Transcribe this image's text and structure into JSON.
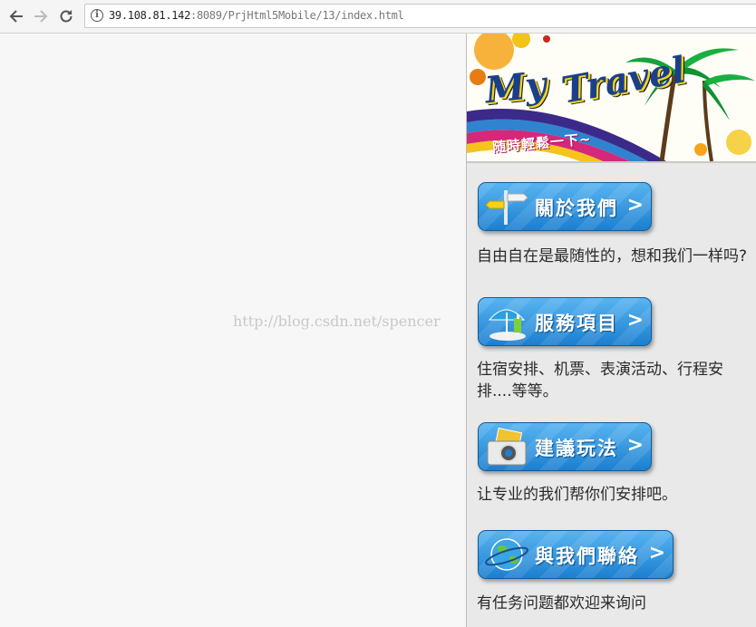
{
  "browser": {
    "url_host": "39.108.81.142",
    "url_rest": ":8089/PrjHtml5Mobile/13/index.html"
  },
  "watermark": "http://blog.csdn.net/spencer",
  "banner": {
    "title_word1": "My",
    "title_word2": "Travel",
    "subtitle": "随時輕鬆一下~"
  },
  "menu": [
    {
      "label": "關於我們",
      "chevron": ">",
      "desc": "自由自在是最随性的，想和我们一样吗?"
    },
    {
      "label": "服務項目",
      "chevron": ">",
      "desc": "住宿安排、机票、表演活动、行程安排....等等。"
    },
    {
      "label": "建議玩法",
      "chevron": ">",
      "desc": "让专业的我们帮你们安排吧。"
    },
    {
      "label": "與我們聯絡",
      "chevron": ">",
      "desc": "有任务问题都欢迎来询问"
    }
  ]
}
